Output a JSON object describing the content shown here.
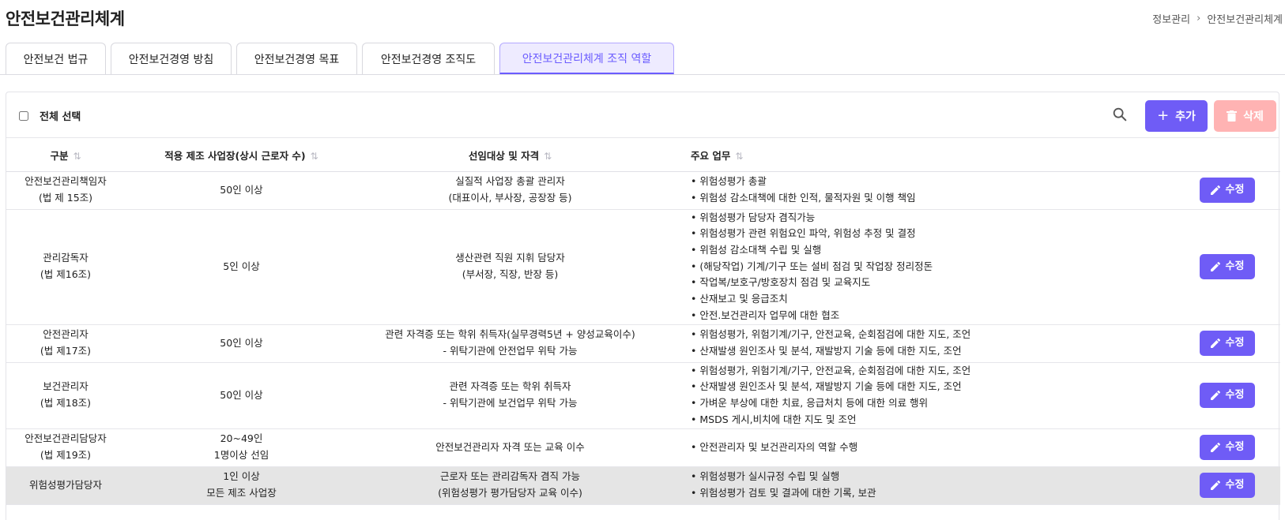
{
  "page": {
    "title": "안전보건관리체계",
    "breadcrumb": [
      "정보관리",
      "안전보건관리체계"
    ]
  },
  "tabs": [
    {
      "label": "안전보건 법규",
      "active": false
    },
    {
      "label": "안전보건경영 방침",
      "active": false
    },
    {
      "label": "안전보건경영 목표",
      "active": false
    },
    {
      "label": "안전보건경영 조직도",
      "active": false
    },
    {
      "label": "안전보건관리체계 조직 역할",
      "active": true
    }
  ],
  "toolbar": {
    "select_all_label": "전체 선택",
    "add_label": "추가",
    "delete_label": "삭제",
    "search_icon": "search-icon"
  },
  "table": {
    "columns": [
      "구분",
      "적용 제조 사업장(상시 근로자 수)",
      "선임대상 및 자격",
      "주요 업무"
    ],
    "edit_label": "수정",
    "rows": [
      {
        "category": [
          "안전보건관리책임자",
          "(법 제 15조)"
        ],
        "scope": [
          "50인 이상"
        ],
        "qualification": [
          "실질적 사업장 총괄 관리자",
          "(대표이사, 부사장, 공장장 등)"
        ],
        "duties": [
          "위험성평가 총괄",
          "위험성 감소대책에 대한 인적, 물적자원 및 이행 책임"
        ]
      },
      {
        "category": [
          "관리감독자",
          "(법 제16조)"
        ],
        "scope": [
          "5인 이상"
        ],
        "qualification": [
          "생산관련 직원 지휘 담당자",
          "(부서장, 직장, 반장 등)"
        ],
        "duties": [
          "위험성평가 담당자 겸직가능",
          "위험성평가 관련 위험요인 파악, 위험성 추정 및 결정",
          "위험성 감소대책 수립 및 실행",
          "(해당작업) 기계/기구 또는 설비 점검 및 작업장 정리정돈",
          "작업복/보호구/방호장치 점검 및 교육지도",
          "산재보고 및 응급조치",
          "안전.보건관리자 업무에 대한 협조"
        ]
      },
      {
        "category": [
          "안전관리자",
          "(법 제17조)"
        ],
        "scope": [
          "50인 이상"
        ],
        "qualification": [
          "관련 자격증 또는 학위 취득자(실무경력5년 + 양성교육이수)",
          "- 위탁기관에 안전업무 위탁 가능"
        ],
        "duties": [
          "위험성평가, 위험기계/기구, 안전교육, 순회점검에 대한 지도, 조언",
          "산재발생 원인조사 및 분석, 재발방지 기술 등에 대한 지도, 조언"
        ]
      },
      {
        "category": [
          "보건관리자",
          "(법 제18조)"
        ],
        "scope": [
          "50인 이상"
        ],
        "qualification": [
          "관련 자격증 또는 학위 취득자",
          "- 위탁기관에 보건업무 위탁 가능"
        ],
        "duties": [
          "위험성평가, 위험기계/기구, 안전교육, 순회점검에 대한 지도, 조언",
          "산재발생 원인조사 및 분석, 재발방지 기술 등에 대한 지도, 조언",
          "가벼운 부상에 대한 치료, 응급처치 등에 대한 의료 행위",
          "MSDS 게시,비치에 대한 지도 및 조언"
        ]
      },
      {
        "category": [
          "안전보건관리담당자",
          "(법 제19조)"
        ],
        "scope": [
          "20~49인",
          "1명이상 선임"
        ],
        "qualification": [
          "안전보건관리자 자격 또는 교육 이수"
        ],
        "duties": [
          "안전관리자 및 보건관리자의 역할 수행"
        ]
      },
      {
        "category": [
          "위험성평가담당자"
        ],
        "scope": [
          "1인 이상",
          "모든 제조 사업장"
        ],
        "qualification": [
          "근로자 또는 관리감독자 겸직 가능",
          "(위험성평가 평가담당자 교육 이수)"
        ],
        "duties": [
          "위험성평가 실시규정 수립 및 실행",
          "위험성평가 검토 및 결과에 대한 기록, 보관"
        ],
        "highlighted": true
      }
    ]
  }
}
